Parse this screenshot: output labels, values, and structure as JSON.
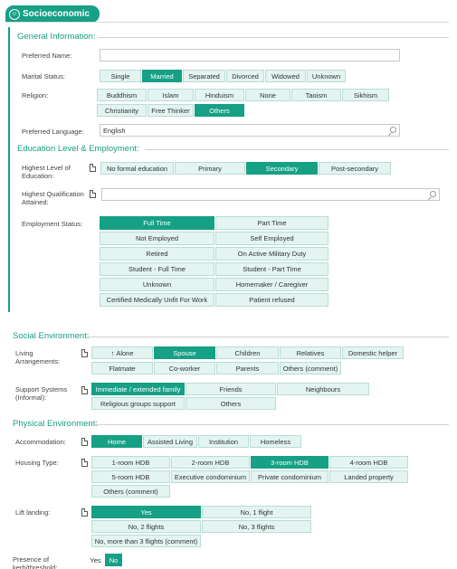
{
  "header": {
    "title": "Socioeconomic",
    "icon": "person-badge-icon"
  },
  "general": {
    "title": "General Information:",
    "preferred_name": {
      "label": "Preferred Name:",
      "value": ""
    },
    "marital": {
      "label": "Marital Status:",
      "options": [
        "Single",
        "Married",
        "Separated",
        "Divorced",
        "Widowed",
        "Unknown"
      ],
      "selected": "Married"
    },
    "religion": {
      "label": "Religion:",
      "options": [
        "Buddhism",
        "Islam",
        "Hinduism",
        "None",
        "Taoism",
        "Sikhism",
        "Christianity",
        "Free Thinker",
        "Others"
      ],
      "selected": "Others"
    },
    "language": {
      "label": "Preferred Language:",
      "value": "English"
    }
  },
  "education": {
    "title": "Education Level & Employment:",
    "highest_level": {
      "label": "Highest Level of Education:",
      "options": [
        "No formal education",
        "Primary",
        "Secondary",
        "Post-secondary"
      ],
      "selected": "Secondary"
    },
    "qualification": {
      "label": "Highest Qualification Attained:",
      "value": ""
    },
    "employment": {
      "label": "Employment Status:",
      "options": [
        "Full Time",
        "Part Time",
        "Not Employed",
        "Self Employed",
        "Retired",
        "On Active Military Duty",
        "Student - Full Time",
        "Student - Part Time",
        "Unknown",
        "Homemaker / Caregiver",
        "Certified Medically Unfit For Work",
        "Patient refused"
      ],
      "selected": "Full Time"
    }
  },
  "social": {
    "title": "Social Environment:",
    "living": {
      "label": "Living Arrangements:",
      "options": [
        "Alone",
        "Spouse",
        "Children",
        "Relatives",
        "Domestic helper",
        "Flatmate",
        "Co-worker",
        "Parents",
        "Others (comment)"
      ],
      "selected": "Spouse"
    },
    "support": {
      "label": "Support Systems (Informal):",
      "options": [
        "Immediate / extended family",
        "Friends",
        "Neighbours",
        "Religious groups support",
        "Others"
      ],
      "selected": "Immediate / extended family"
    }
  },
  "physical": {
    "title": "Physical Environment:",
    "accommodation": {
      "label": "Accommodation:",
      "options": [
        "Home",
        "Assisted Living",
        "Institution",
        "Homeless"
      ],
      "selected": "Home"
    },
    "housing": {
      "label": "Housing Type:",
      "options": [
        "1-room HDB",
        "2-room HDB",
        "3-room HDB",
        "4-room HDB",
        "5-room HDB",
        "Executive condominium",
        "Private condominium",
        "Landed property",
        "Others (comment)"
      ],
      "selected": "3-room HDB"
    },
    "lift": {
      "label": "Lift landing:",
      "options": [
        "Yes",
        "No, 1 flight",
        "No, 2 flights",
        "No, 3 flights",
        "No, more than 3 flights (comment)"
      ],
      "selected": "Yes"
    },
    "kerb": {
      "label": "Presence of kerb/threshold:",
      "options": [
        "Yes",
        "No"
      ],
      "selected": "No"
    }
  },
  "colors": {
    "accent": "#16a085",
    "option_bg": "#e3f4f1"
  }
}
